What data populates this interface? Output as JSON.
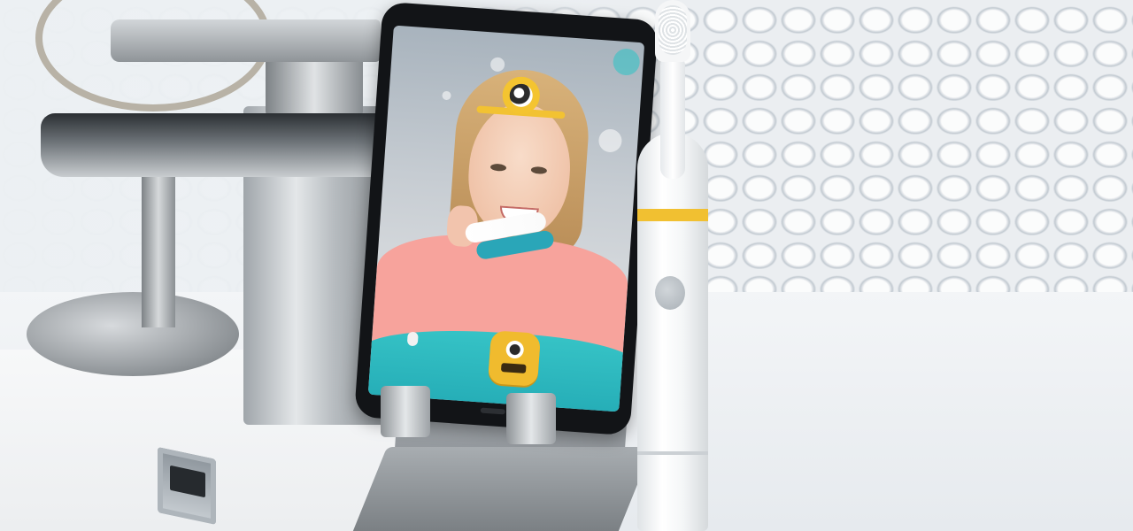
{
  "scene": {
    "subject": "phone-on-stand-with-toothbrush",
    "colors": {
      "accent_yellow": "#f1c031",
      "teal": "#22a9b4",
      "shirt_pink": "#f7a39c",
      "toothbrush_white": "#ffffff",
      "stand_gray": "#a8adb1"
    }
  }
}
